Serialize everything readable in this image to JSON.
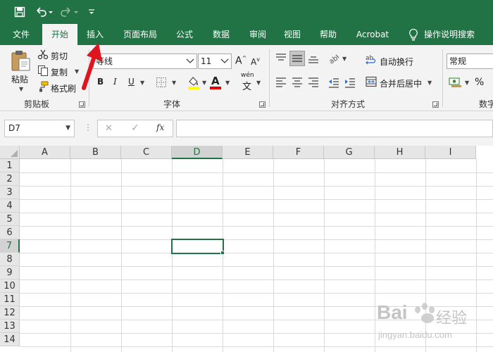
{
  "quick_access": {
    "save_icon": "save-icon",
    "undo_icon": "undo-icon",
    "redo_icon": "redo-icon",
    "customize_icon": "customize-icon"
  },
  "tabs": [
    {
      "label": "文件"
    },
    {
      "label": "开始"
    },
    {
      "label": "插入"
    },
    {
      "label": "页面布局"
    },
    {
      "label": "公式"
    },
    {
      "label": "数据"
    },
    {
      "label": "审阅"
    },
    {
      "label": "视图"
    },
    {
      "label": "帮助"
    },
    {
      "label": "Acrobat"
    },
    {
      "label": "操作说明搜索"
    }
  ],
  "clipboard": {
    "paste_label": "粘贴",
    "cut_label": "剪切",
    "copy_label": "复制",
    "format_painter_label": "格式刷",
    "group_label": "剪贴板"
  },
  "font": {
    "font_name": "等线",
    "font_size": "11",
    "grow_label": "A",
    "shrink_label": "A",
    "bold": "B",
    "italic": "I",
    "underline": "U",
    "font_color_label": "A",
    "phonetic_label": "wén",
    "phonetic_char": "文",
    "group_label": "字体"
  },
  "alignment": {
    "wrap_text_label": "自动换行",
    "merge_center_label": "合并后居中",
    "group_label": "对齐方式"
  },
  "number": {
    "format": "常规",
    "percent": "%",
    "group_label": "数字"
  },
  "formula_bar": {
    "name_box": "D7",
    "cancel": "✕",
    "enter": "✓",
    "fx": "fx",
    "content": ""
  },
  "grid": {
    "columns": [
      "A",
      "B",
      "C",
      "D",
      "E",
      "F",
      "G",
      "H",
      "I"
    ],
    "rows": [
      "1",
      "2",
      "3",
      "4",
      "5",
      "6",
      "7",
      "8",
      "9",
      "10",
      "11",
      "12",
      "13",
      "14"
    ],
    "selected_column": "D",
    "selected_row": "7"
  },
  "watermark": {
    "brand_text": "Bai",
    "brand_suffix": "经验",
    "url": "jingyan.baidu.com"
  },
  "colors": {
    "excel_green": "#217346",
    "arrow_red": "#e0141e",
    "font_color_red": "#e00000",
    "highlight_yellow": "#ffff00"
  }
}
